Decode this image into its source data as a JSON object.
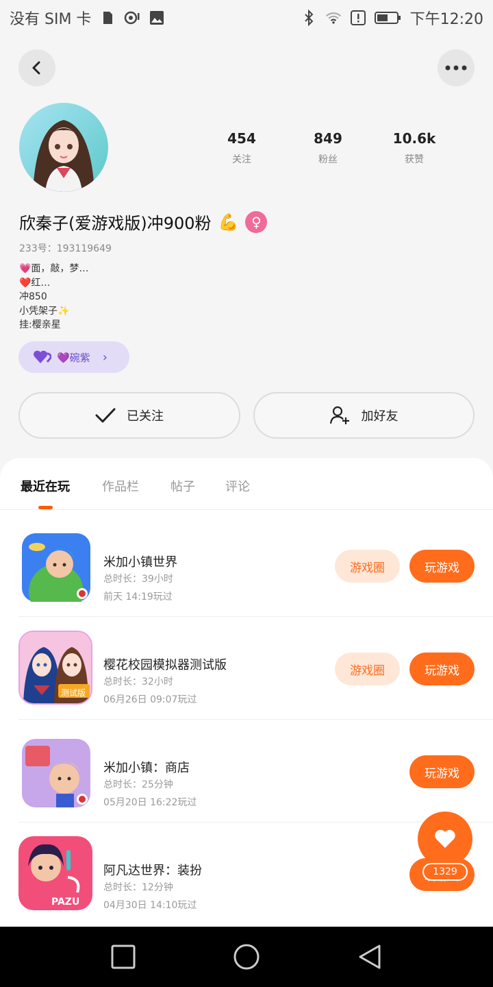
{
  "status_bar": {
    "carrier": "没有 SIM 卡",
    "time": "下午12:20"
  },
  "profile": {
    "stats": [
      {
        "value": "454",
        "label": "关注"
      },
      {
        "value": "849",
        "label": "粉丝"
      },
      {
        "value": "10.6k",
        "label": "获赞"
      }
    ],
    "username": "欣秦子(爱游戏版)冲900粉",
    "username_emoji": "💪",
    "gender_symbol": "♀",
    "user_id": "233号：193119649",
    "bio_lines": [
      "💗面，敲，梦…",
      "❤️红…",
      "冲850",
      "小凭架子✨",
      "挂:樱亲星"
    ],
    "tag_pill": "💜碗紫",
    "follow_button": "已关注",
    "add_friend_button": "加好友"
  },
  "tabs": [
    "最近在玩",
    "作品栏",
    "帖子",
    "评论"
  ],
  "games": [
    {
      "title": "米加小镇世界",
      "duration": "总时长：39小时",
      "last_played": "前天 14:19玩过",
      "circle_btn": "游戏圈",
      "play_btn": "玩游戏"
    },
    {
      "title": "樱花校园模拟器测试版",
      "duration": "总时长：32小时",
      "last_played": "06月26日 09:07玩过",
      "circle_btn": "游戏圈",
      "play_btn": "玩游戏"
    },
    {
      "title": "米加小镇：商店",
      "duration": "总时长：25分钟",
      "last_played": "05月20日 16:22玩过",
      "play_btn": "玩游戏"
    },
    {
      "title": "阿凡达世界：装扮",
      "duration": "总时长：12分钟",
      "last_played": "04月30日 14:10玩过",
      "play_btn": "玩游戏"
    }
  ],
  "icons": {
    "game2_badge": "测试版",
    "game4_brand": "PAZU"
  },
  "like_count": "1329",
  "colors": {
    "accent": "#ff6c1c",
    "accent_light": "#ffe7d7",
    "pill_bg": "#e3dcf7"
  }
}
